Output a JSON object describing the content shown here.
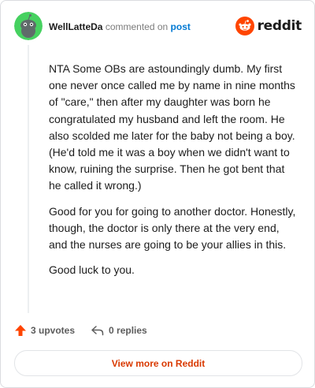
{
  "header": {
    "username": "WellLatteDa",
    "verb": "commented on",
    "post_link": "post"
  },
  "logo": {
    "wordmark": "reddit",
    "brand_color": "#ff4500"
  },
  "comment": {
    "paragraphs": [
      "NTA Some OBs are astoundingly dumb. My first one never once called me by name in nine months of \"care,\" then after my daughter was born he congratulated my husband and left the room. He also scolded me later for the baby not being a boy. (He'd told me it was a boy when we didn't want to know, ruining the surprise. Then he got bent that he called it wrong.)",
      "Good for you for going to another doctor. Honestly, though, the doctor is only there at the very end, and the nurses are going to be your allies in this.",
      "Good luck to you."
    ]
  },
  "actions": {
    "upvotes": "3 upvotes",
    "replies": "0 replies",
    "upvote_color": "#ff4500"
  },
  "view_more": {
    "label": "View more on Reddit",
    "color": "#d93900"
  },
  "icons": {
    "avatar": "snoo-avatar-icon",
    "logo": "reddit-snoo-icon",
    "upvote": "upvote-arrow-icon",
    "reply": "reply-arrow-icon"
  }
}
